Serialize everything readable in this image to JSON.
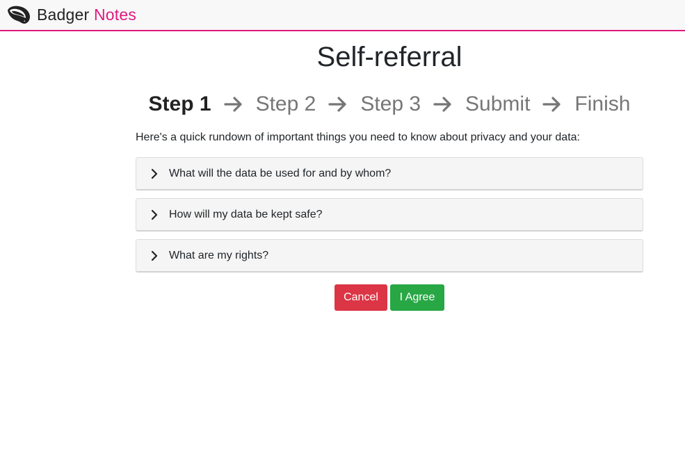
{
  "brand": {
    "name_part1": "Badger",
    "name_part2": "Notes",
    "logo_icon": "badger-head-icon",
    "accent_color": "#e0197d"
  },
  "page": {
    "title": "Self-referral",
    "intro": "Here's a quick rundown of important things you need to know about privacy and your data:"
  },
  "steps": [
    {
      "label": "Step 1",
      "active": true
    },
    {
      "label": "Step 2",
      "active": false
    },
    {
      "label": "Step 3",
      "active": false
    },
    {
      "label": "Submit",
      "active": false
    },
    {
      "label": "Finish",
      "active": false
    }
  ],
  "accordion": [
    {
      "label": "What will the data be used for and by whom?",
      "icon": "chevron-right-icon",
      "expanded": false
    },
    {
      "label": "How will my data be kept safe?",
      "icon": "chevron-right-icon",
      "expanded": false
    },
    {
      "label": "What are my rights?",
      "icon": "chevron-right-icon",
      "expanded": false
    }
  ],
  "actions": {
    "cancel_label": "Cancel",
    "agree_label": "I Agree",
    "cancel_color": "#dc3545",
    "agree_color": "#28a745"
  }
}
